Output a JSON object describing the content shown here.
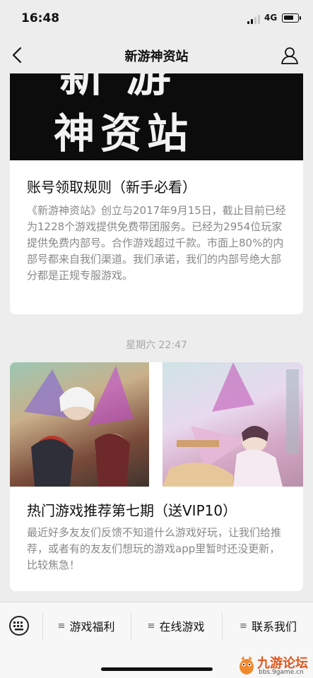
{
  "status_bar": {
    "time": "16:48",
    "network": "4G"
  },
  "nav": {
    "title": "新游神资站",
    "back_icon": "chevron-left-icon",
    "profile_icon": "user-icon"
  },
  "articles": [
    {
      "banner_text_top": "新游",
      "banner_text": "神资站",
      "title": "账号领取规则（新手必看）",
      "description": "《新游神资站》创立与2017年9月15日，截止目前已经为1228个游戏提供免费带团服务。已经为2954位玩家提供免费内部号。合作游戏超过千款。市面上80%的内部号都来自我们渠道。我们承诺，我们的内部号绝大部分都是正规专服游戏。"
    },
    {
      "title": "热门游戏推荐第七期（送VIP10）",
      "description": "最近好多友友们反馈不知道什么游戏好玩，让我们给推荐，或者有的友友们想玩的游戏app里暂时还没更新，比较焦急！"
    }
  ],
  "timestamp": "星期六 22:47",
  "bottom_menu": {
    "keyboard_icon": "keyboard-icon",
    "items": [
      {
        "label": "游戏福利",
        "glyph": "≡"
      },
      {
        "label": "在线游戏",
        "glyph": "≡"
      },
      {
        "label": "联系我们",
        "glyph": "≡"
      }
    ]
  },
  "watermark": {
    "title": "九游论坛",
    "url": "bbs.9game.cn"
  }
}
